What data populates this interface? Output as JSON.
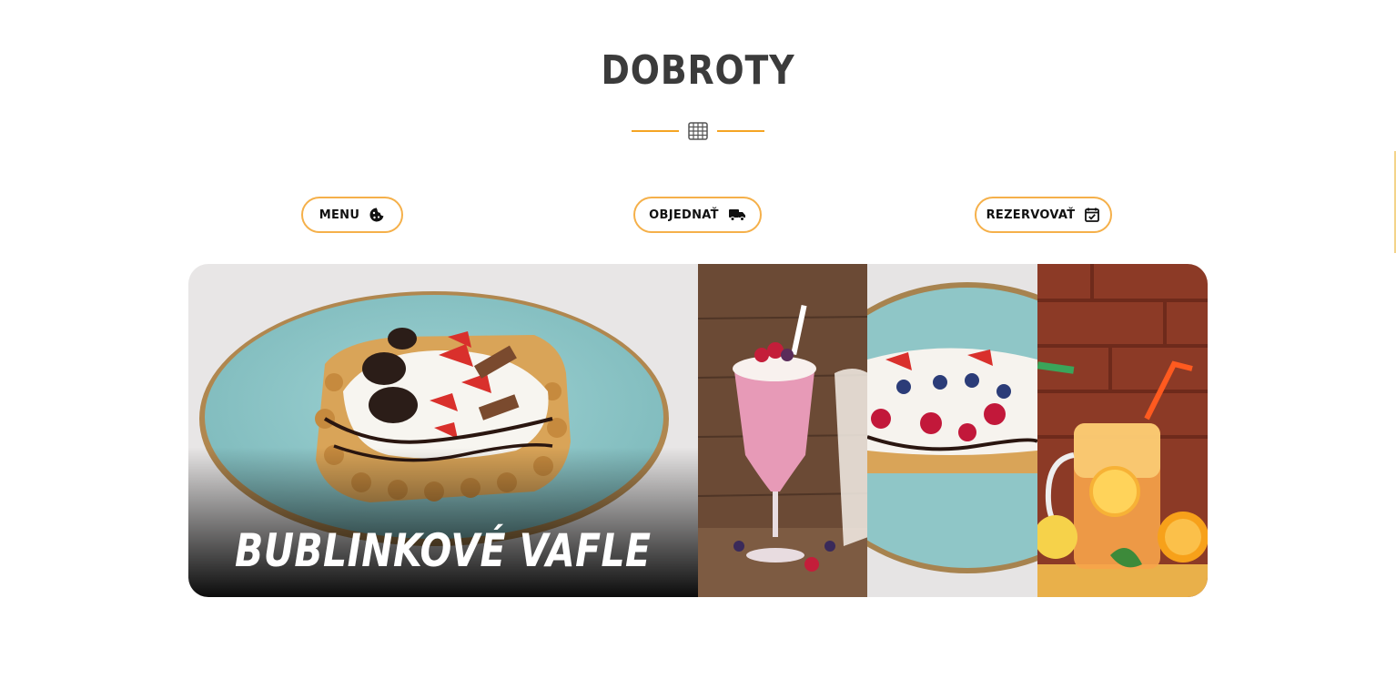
{
  "section": {
    "title": "DOBROTY"
  },
  "buttons": [
    {
      "label": "MENU",
      "icon": "cookie-icon"
    },
    {
      "label": "OBJEDNAŤ",
      "icon": "delivery-truck-icon"
    },
    {
      "label": "REZERVOVAŤ",
      "icon": "calendar-check-icon"
    }
  ],
  "gallery": {
    "active_caption": "BUBLINKOVÉ VAFLE",
    "panels": [
      "waffle-with-oreo",
      "berry-milkshake",
      "berry-waffle",
      "orange-lemonade"
    ]
  },
  "colors": {
    "accent": "#f5a524",
    "title": "#3b3b3b",
    "plate": "#8fc9cb"
  }
}
